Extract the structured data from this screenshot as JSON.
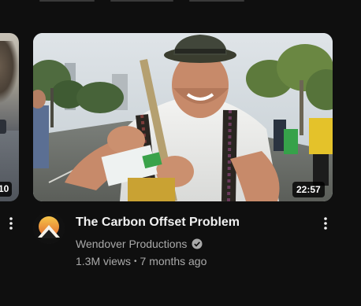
{
  "previous_card": {
    "duration": "10"
  },
  "video": {
    "title": "The Carbon Offset Problem",
    "channel": "Wendover Productions",
    "views": "1.3M views",
    "separator": "•",
    "age": "7 months ago",
    "duration": "22:57"
  },
  "icons": {
    "menu": "more-vert-icon",
    "verified": "verified-check-icon",
    "avatar": "channel-avatar"
  },
  "colors": {
    "background": "#0f0f0f",
    "primary_text": "#f1f1f1",
    "secondary_text": "#aaaaaa"
  }
}
